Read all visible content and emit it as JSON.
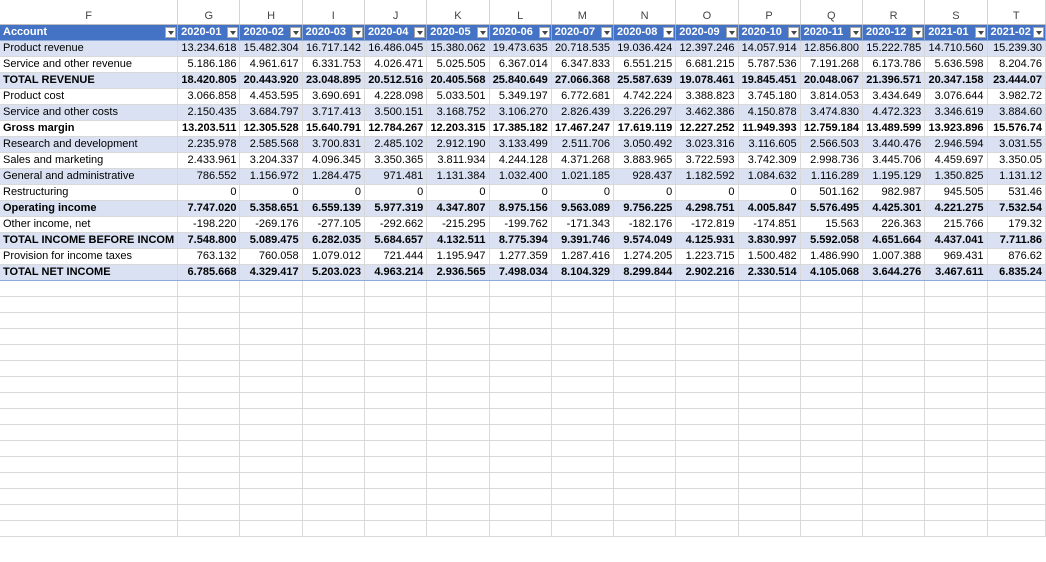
{
  "columns": [
    "F",
    "G",
    "H",
    "I",
    "J",
    "K",
    "L",
    "M",
    "N",
    "O",
    "P",
    "Q",
    "R",
    "S",
    "T"
  ],
  "header": {
    "account": "Account",
    "periods": [
      "2020-01",
      "2020-02",
      "2020-03",
      "2020-04",
      "2020-05",
      "2020-06",
      "2020-07",
      "2020-08",
      "2020-09",
      "2020-10",
      "2020-11",
      "2020-12",
      "2021-01",
      "2021-02"
    ]
  },
  "rows": [
    {
      "name": "Product revenue",
      "bold": false,
      "values": [
        "13.234.618",
        "15.482.304",
        "16.717.142",
        "16.486.045",
        "15.380.062",
        "19.473.635",
        "20.718.535",
        "19.036.424",
        "12.397.246",
        "14.057.914",
        "12.856.800",
        "15.222.785",
        "14.710.560",
        "15.239.30"
      ]
    },
    {
      "name": "Service and other revenue",
      "bold": false,
      "values": [
        "5.186.186",
        "4.961.617",
        "6.331.753",
        "4.026.471",
        "5.025.505",
        "6.367.014",
        "6.347.833",
        "6.551.215",
        "6.681.215",
        "5.787.536",
        "7.191.268",
        "6.173.786",
        "5.636.598",
        "8.204.76"
      ]
    },
    {
      "name": "TOTAL REVENUE",
      "bold": true,
      "values": [
        "18.420.805",
        "20.443.920",
        "23.048.895",
        "20.512.516",
        "20.405.568",
        "25.840.649",
        "27.066.368",
        "25.587.639",
        "19.078.461",
        "19.845.451",
        "20.048.067",
        "21.396.571",
        "20.347.158",
        "23.444.07"
      ]
    },
    {
      "name": "Product cost",
      "bold": false,
      "values": [
        "3.066.858",
        "4.453.595",
        "3.690.691",
        "4.228.098",
        "5.033.501",
        "5.349.197",
        "6.772.681",
        "4.742.224",
        "3.388.823",
        "3.745.180",
        "3.814.053",
        "3.434.649",
        "3.076.644",
        "3.982.72"
      ]
    },
    {
      "name": "Service and other costs",
      "bold": false,
      "values": [
        "2.150.435",
        "3.684.797",
        "3.717.413",
        "3.500.151",
        "3.168.752",
        "3.106.270",
        "2.826.439",
        "3.226.297",
        "3.462.386",
        "4.150.878",
        "3.474.830",
        "4.472.323",
        "3.346.619",
        "3.884.60"
      ]
    },
    {
      "name": "Gross margin",
      "bold": true,
      "values": [
        "13.203.511",
        "12.305.528",
        "15.640.791",
        "12.784.267",
        "12.203.315",
        "17.385.182",
        "17.467.247",
        "17.619.119",
        "12.227.252",
        "11.949.393",
        "12.759.184",
        "13.489.599",
        "13.923.896",
        "15.576.74"
      ]
    },
    {
      "name": "Research and development",
      "bold": false,
      "values": [
        "2.235.978",
        "2.585.568",
        "3.700.831",
        "2.485.102",
        "2.912.190",
        "3.133.499",
        "2.511.706",
        "3.050.492",
        "3.023.316",
        "3.116.605",
        "2.566.503",
        "3.440.476",
        "2.946.594",
        "3.031.55"
      ]
    },
    {
      "name": "Sales and marketing",
      "bold": false,
      "values": [
        "2.433.961",
        "3.204.337",
        "4.096.345",
        "3.350.365",
        "3.811.934",
        "4.244.128",
        "4.371.268",
        "3.883.965",
        "3.722.593",
        "3.742.309",
        "2.998.736",
        "3.445.706",
        "4.459.697",
        "3.350.05"
      ]
    },
    {
      "name": "General and administrative",
      "bold": false,
      "values": [
        "786.552",
        "1.156.972",
        "1.284.475",
        "971.481",
        "1.131.384",
        "1.032.400",
        "1.021.185",
        "928.437",
        "1.182.592",
        "1.084.632",
        "1.116.289",
        "1.195.129",
        "1.350.825",
        "1.131.12"
      ]
    },
    {
      "name": "Restructuring",
      "bold": false,
      "values": [
        "0",
        "0",
        "0",
        "0",
        "0",
        "0",
        "0",
        "0",
        "0",
        "0",
        "501.162",
        "982.987",
        "945.505",
        "531.46"
      ]
    },
    {
      "name": "Operating income",
      "bold": true,
      "values": [
        "7.747.020",
        "5.358.651",
        "6.559.139",
        "5.977.319",
        "4.347.807",
        "8.975.156",
        "9.563.089",
        "9.756.225",
        "4.298.751",
        "4.005.847",
        "5.576.495",
        "4.425.301",
        "4.221.275",
        "7.532.54"
      ]
    },
    {
      "name": "Other income, net",
      "bold": false,
      "values": [
        "-198.220",
        "-269.176",
        "-277.105",
        "-292.662",
        "-215.295",
        "-199.762",
        "-171.343",
        "-182.176",
        "-172.819",
        "-174.851",
        "15.563",
        "226.363",
        "215.766",
        "179.32"
      ]
    },
    {
      "name": "TOTAL INCOME BEFORE INCOM",
      "bold": true,
      "values": [
        "7.548.800",
        "5.089.475",
        "6.282.035",
        "5.684.657",
        "4.132.511",
        "8.775.394",
        "9.391.746",
        "9.574.049",
        "4.125.931",
        "3.830.997",
        "5.592.058",
        "4.651.664",
        "4.437.041",
        "7.711.86"
      ]
    },
    {
      "name": "Provision for income taxes",
      "bold": false,
      "values": [
        "763.132",
        "760.058",
        "1.079.012",
        "721.444",
        "1.195.947",
        "1.277.359",
        "1.287.416",
        "1.274.205",
        "1.223.715",
        "1.500.482",
        "1.486.990",
        "1.007.388",
        "969.431",
        "876.62"
      ]
    },
    {
      "name": "TOTAL NET INCOME",
      "bold": true,
      "values": [
        "6.785.668",
        "4.329.417",
        "5.203.023",
        "4.963.214",
        "2.936.565",
        "7.498.034",
        "8.104.329",
        "8.299.844",
        "2.902.216",
        "2.330.514",
        "4.105.068",
        "3.644.276",
        "3.467.611",
        "6.835.24"
      ]
    }
  ],
  "empty_rows": 16
}
